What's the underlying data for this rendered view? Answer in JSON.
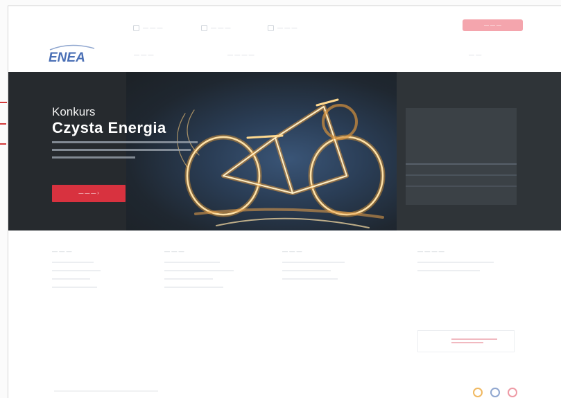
{
  "topbar": {
    "links": [
      {
        "label": "— — —",
        "icon": "user-icon"
      },
      {
        "label": "— — —",
        "icon": "document-icon"
      },
      {
        "label": "— — —",
        "icon": "phone-icon"
      }
    ],
    "cta": "— — —"
  },
  "nav": {
    "logo_text": "ENEA",
    "items": [
      "— — —",
      "— — — —"
    ],
    "right_item": "— —"
  },
  "hero": {
    "title_line1": "Konkurs",
    "title_line2": "Czysta Energia",
    "button": "— — — ›"
  },
  "footer": {
    "columns": [
      {
        "heading": "— — —"
      },
      {
        "heading": "— — —"
      },
      {
        "heading": "— — —"
      },
      {
        "heading": "— — — —"
      }
    ],
    "social_icons": [
      "facebook-icon",
      "linkedin-icon",
      "youtube-icon"
    ]
  },
  "colors": {
    "accent": "#d8323f",
    "cta_light": "#f4a5ad",
    "hero_bg": "#262a2e",
    "logo_blue": "#4a6fb5"
  }
}
